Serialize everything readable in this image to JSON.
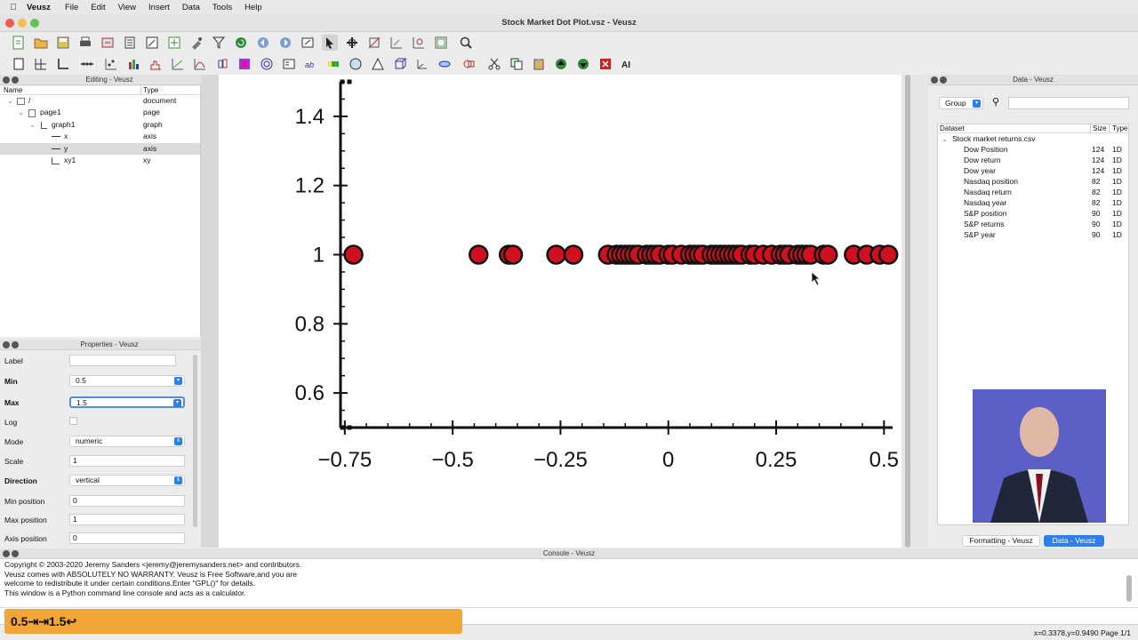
{
  "menubar": {
    "app": "Veusz",
    "items": [
      "File",
      "Edit",
      "View",
      "Insert",
      "Data",
      "Tools",
      "Help"
    ]
  },
  "window": {
    "title": "Stock Market Dot Plot.vsz - Veusz"
  },
  "editing": {
    "title": "Editing - Veusz",
    "col_name": "Name",
    "col_type": "Type",
    "rows": [
      {
        "name": "/",
        "type": "document"
      },
      {
        "name": "page1",
        "type": "page"
      },
      {
        "name": "graph1",
        "type": "graph"
      },
      {
        "name": "x",
        "type": "axis"
      },
      {
        "name": "y",
        "type": "axis"
      },
      {
        "name": "xy1",
        "type": "xy"
      }
    ]
  },
  "properties": {
    "title": "Properties - Veusz",
    "label": "Label",
    "label_value": "",
    "min": "Min",
    "min_value": "0.5",
    "max": "Max",
    "max_value": "1.5",
    "log": "Log",
    "mode": "Mode",
    "mode_value": "numeric",
    "scale": "Scale",
    "scale_value": "1",
    "direction": "Direction",
    "direction_value": "vertical",
    "min_position": "Min position",
    "min_position_value": "0",
    "max_position": "Max position",
    "max_position_value": "1",
    "axis_position": "Axis position",
    "axis_position_value": "0"
  },
  "data_panel": {
    "title": "Data - Veusz",
    "group_label": "Group",
    "search_placeholder": "",
    "col_dataset": "Dataset",
    "col_size": "Size",
    "col_type": "Type",
    "file": "Stock market returns.csv",
    "datasets": [
      {
        "name": "Dow Position",
        "size": "124",
        "type": "1D"
      },
      {
        "name": "Dow return",
        "size": "124",
        "type": "1D"
      },
      {
        "name": "Dow year",
        "size": "124",
        "type": "1D"
      },
      {
        "name": "Nasdaq position",
        "size": "82",
        "type": "1D"
      },
      {
        "name": "Nasdaq return",
        "size": "82",
        "type": "1D"
      },
      {
        "name": "Nasdaq year",
        "size": "82",
        "type": "1D"
      },
      {
        "name": "S&P position",
        "size": "90",
        "type": "1D"
      },
      {
        "name": "S&P returns",
        "size": "90",
        "type": "1D"
      },
      {
        "name": "S&P year",
        "size": "90",
        "type": "1D"
      }
    ],
    "tab_formatting": "Formatting - Veusz",
    "tab_data": "Data - Veusz"
  },
  "console": {
    "title": "Console - Veusz",
    "text": "Copyright © 2003-2020 Jeremy Sanders <jeremy@jeremysanders.net> and contributors.\nVeusz comes with ABSOLUTELY NO WARRANTY. Veusz is Free Software,and you are\nwelcome to redistribute it under certain conditions.Enter \"GPL()\" for details.\nThis window is a Python command line console and acts as a calculator.",
    "prompt": ">"
  },
  "status": {
    "text": "x=0.3378,y=0.9490  Page 1/1"
  },
  "overlay": {
    "text": "0.5⇥⇥1.5↩"
  },
  "colors": {
    "marker_fill": "#d0101e",
    "accent": "#2f7fe6",
    "overlay": "#f3a638"
  },
  "chart_data": {
    "type": "scatter",
    "xlim": [
      -0.76,
      0.52
    ],
    "ylim": [
      0.5,
      1.5
    ],
    "xticks": [
      "−0.75",
      "−0.5",
      "−0.25",
      "0",
      "0.25",
      "0.5"
    ],
    "xtick_values": [
      -0.75,
      -0.5,
      -0.25,
      0,
      0.25,
      0.5
    ],
    "yticks": [
      "0.6",
      "0.8",
      "1",
      "1.2",
      "1.4"
    ],
    "ytick_values": [
      0.6,
      0.8,
      1.0,
      1.2,
      1.4
    ],
    "series": [
      {
        "x": [
          -0.73,
          -0.44,
          -0.37,
          -0.36,
          -0.26,
          -0.22,
          -0.14,
          -0.12,
          -0.11,
          -0.1,
          -0.09,
          -0.08,
          -0.07,
          -0.05,
          -0.04,
          -0.03,
          -0.02,
          0.0,
          0.01,
          0.03,
          0.05,
          0.06,
          0.07,
          0.08,
          0.1,
          0.11,
          0.12,
          0.13,
          0.14,
          0.15,
          0.16,
          0.17,
          0.19,
          0.2,
          0.22,
          0.24,
          0.26,
          0.27,
          0.28,
          0.3,
          0.31,
          0.32,
          0.33,
          0.36,
          0.37,
          0.43,
          0.46,
          0.49,
          0.51
        ],
        "y": 1.0
      }
    ]
  }
}
